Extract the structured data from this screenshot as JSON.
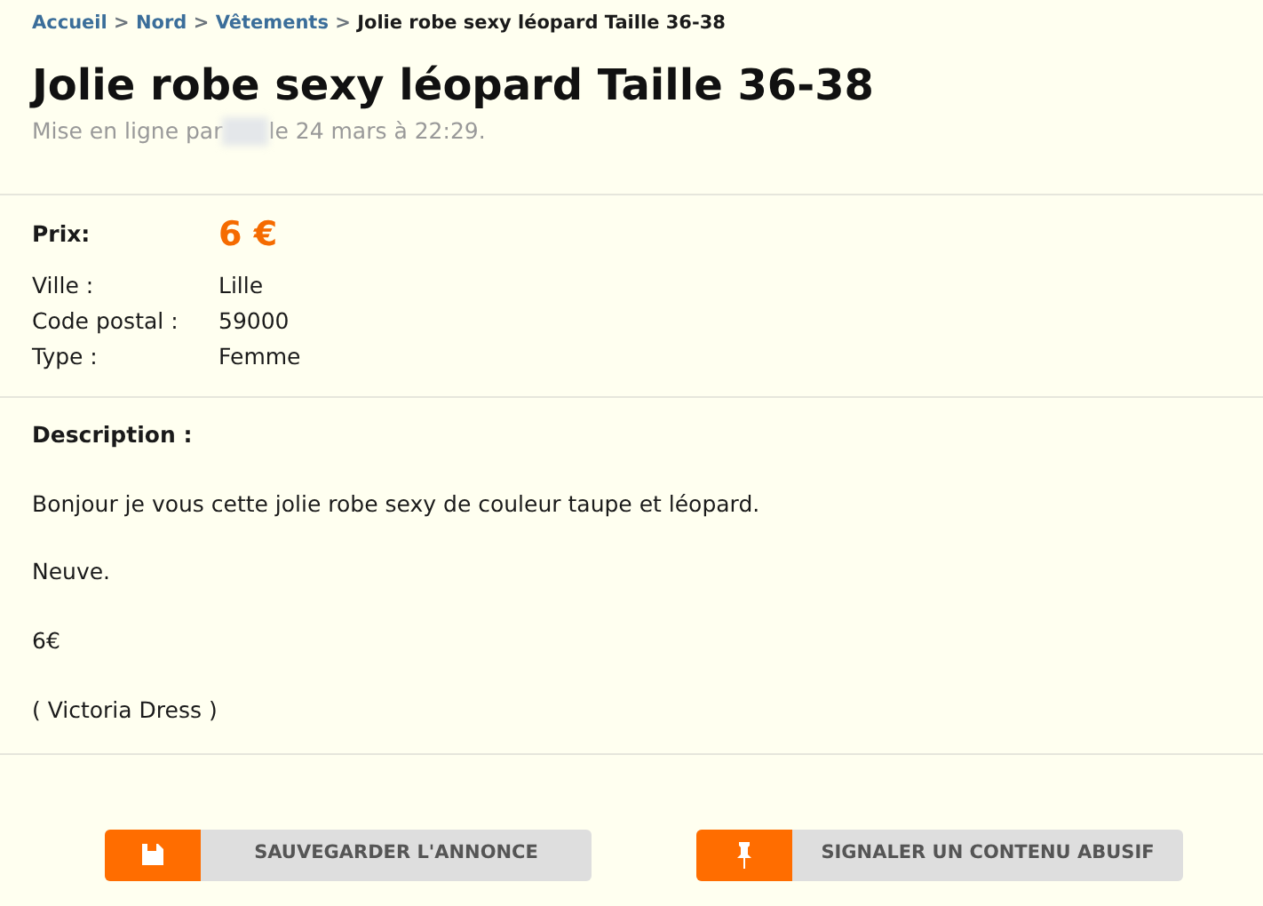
{
  "breadcrumb": {
    "links": [
      "Accueil",
      "Nord",
      "Vêtements"
    ],
    "separator": ">",
    "current": "Jolie robe sexy léopard Taille 36-38"
  },
  "title": "Jolie robe sexy léopard Taille 36-38",
  "posted": {
    "before": "Mise en ligne par",
    "after": "le 24 mars à 22:29."
  },
  "price": {
    "label": "Prix:",
    "value": "6 €"
  },
  "details": [
    {
      "label": "Ville :",
      "value": "Lille"
    },
    {
      "label": "Code postal :",
      "value": "59000"
    },
    {
      "label": "Type :",
      "value": "Femme"
    }
  ],
  "description": {
    "heading": "Description :",
    "paragraphs": [
      "Bonjour je vous cette jolie robe sexy de couleur taupe et léopard.",
      "Neuve.",
      "6€",
      "( Victoria Dress )"
    ]
  },
  "buttons": [
    {
      "kind": "save",
      "label": "SAUVEGARDER L'ANNONCE"
    },
    {
      "kind": "report",
      "label": "SIGNALER UN CONTENU ABUSIF"
    }
  ]
}
